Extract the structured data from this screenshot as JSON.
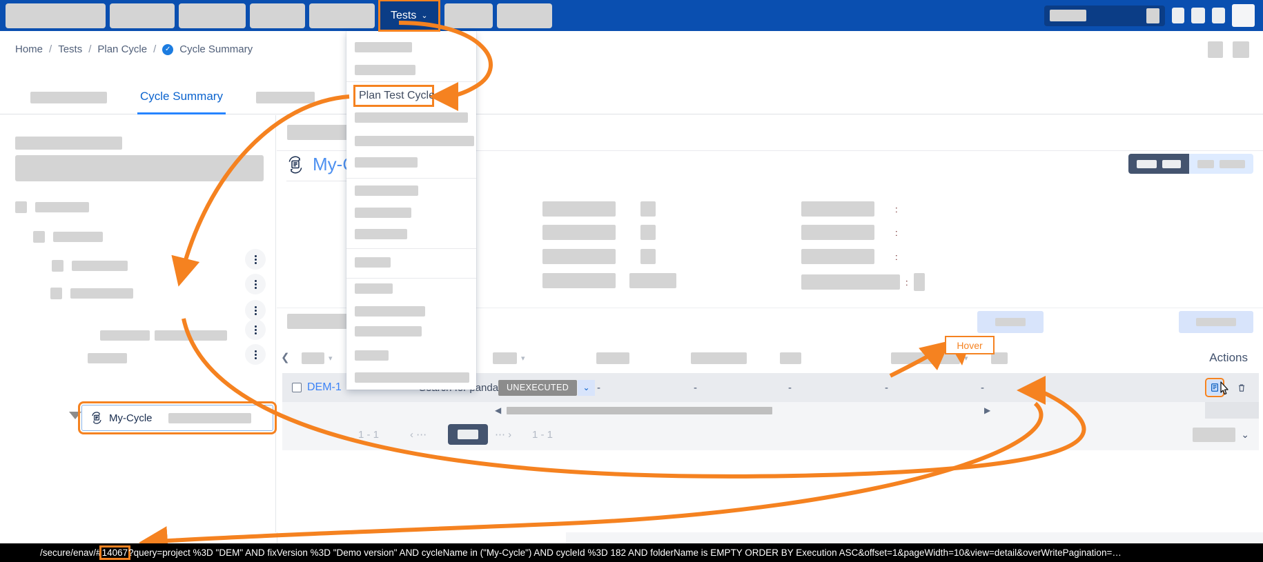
{
  "nav": {
    "tests_label": "Tests",
    "caret": "⌄"
  },
  "breadcrumb": {
    "items": [
      "Home",
      "Tests",
      "Plan Cycle",
      "Cycle Summary"
    ],
    "separator": "/",
    "check_glyph": "✓"
  },
  "tabs": {
    "active_label": "Cycle Summary"
  },
  "dropdown": {
    "highlighted_item": "Plan Test Cycle"
  },
  "left_panel": {
    "tree_selected_label": "My-Cycle"
  },
  "main": {
    "title": "My-Cy",
    "toggle_a": "",
    "toggle_b": ""
  },
  "table": {
    "actions_header": "Actions",
    "row": {
      "key": "DEM-1",
      "summary": "Search for pandas",
      "status": "UNEXECUTED",
      "status_caret": "⌄",
      "dash": "-",
      "execute_icon": "E",
      "delete_icon": "Ὕ1"
    }
  },
  "pager": {
    "left_range": "1 - 1",
    "right_range": "1 - 1",
    "prev": "‹ ⋯",
    "next": "⋯ ›",
    "size_caret": "⌄"
  },
  "annotations": {
    "hover_label": "Hover"
  },
  "status_bar": {
    "prefix": "/secure/enav/#",
    "highlight": "14067",
    "rest": "?query=project %3D \"DEM\" AND fixVersion %3D \"Demo version\" AND cycleName in (\"My-Cycle\") AND cycleId %3D 182 AND folderName is EMPTY ORDER BY Execution ASC&offset=1&pageWidth=10&view=detail&overWritePagination=…"
  },
  "colors": {
    "nav_blue": "#0a4fb0",
    "nav_active": "#0b3d86",
    "accent_orange": "#f58220",
    "link_blue": "#3b82f6",
    "status_gray": "#8c8c8c"
  }
}
